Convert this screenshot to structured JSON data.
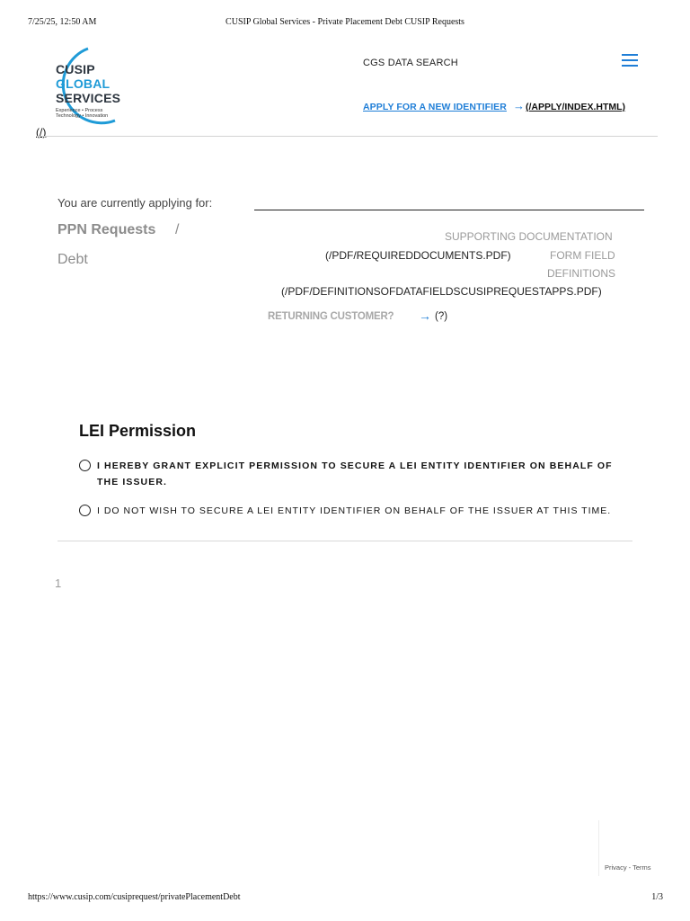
{
  "print_header": {
    "datetime": "7/25/25, 12:50 AM",
    "title": "CUSIP Global Services - Private Placement Debt CUSIP Requests"
  },
  "logo": {
    "line1": "CUSIP",
    "line2": "GLOBAL",
    "line3": "SERVICES",
    "tagline1": "Experience • Process",
    "tagline2": "Technology • Innovation",
    "home_link": "(/)",
    "colors": {
      "blue": "#1f9bd7",
      "dark": "#2d3640"
    }
  },
  "nav": {
    "data_search": "CGS DATA SEARCH",
    "menu_icon": "hamburger-icon",
    "apply_label": "APPLY FOR A NEW IDENTIFIER",
    "apply_arrow": "→",
    "apply_href": "(/APPLY/INDEX.HTML)"
  },
  "applying": {
    "label": "You are currently applying for:",
    "category": "PPN Requests",
    "separator": "/",
    "subcategory": "Debt"
  },
  "docs": {
    "supporting_label": "SUPPORTING DOCUMENTATION",
    "supporting_href": "(/PDF/REQUIREDDOCUMENTS.PDF)",
    "form_field_label_1": "FORM FIELD",
    "form_field_label_2": "DEFINITIONS",
    "definitions_href": "(/PDF/DEFINITIONSOFDATAFIELDSCUSIPREQUESTAPPS.PDF)",
    "returning_label": "RETURNING CUSTOMER?",
    "returning_arrow": "→",
    "returning_href": "(?)"
  },
  "lei": {
    "title": "LEI Permission",
    "option1_line1": "I HEREBY GRANT EXPLICIT PERMISSION TO SECURE A LEI ENTITY IDENTIFIER ON BEHALF OF",
    "option1_line2": "THE ISSUER.",
    "option2": "I DO NOT WISH TO SECURE A LEI ENTITY IDENTIFIER ON BEHALF OF THE ISSUER AT THIS TIME."
  },
  "page_indicator": "1",
  "recaptcha": {
    "links": "Privacy - Terms"
  },
  "print_footer": {
    "url": "https://www.cusip.com/cusiprequest/privatePlacementDebt",
    "page": "1/3"
  },
  "colors": {
    "accent": "#1f7ed7",
    "muted": "#9a9a9a"
  }
}
